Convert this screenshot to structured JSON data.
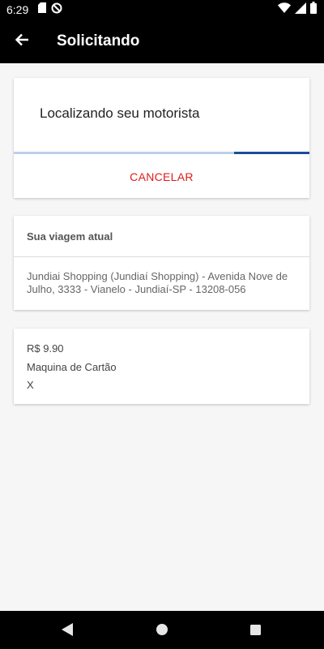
{
  "status_bar": {
    "time": "6:29",
    "icons": [
      "sd-card-icon",
      "no-sync-icon",
      "wifi-icon",
      "cellular-signal-icon",
      "battery-icon"
    ]
  },
  "app_bar": {
    "title": "Solicitando",
    "back_icon": "arrow-back-icon"
  },
  "request_card": {
    "status_text": "Localizando seu motorista",
    "cancel_label": "CANCELAR",
    "accent_color": "#1a4e96",
    "cancel_color": "#e01b1b"
  },
  "trip_card": {
    "header": "Sua viagem atual",
    "address": "Jundiai Shopping (Jundiaí Shopping) - Avenida Nove de Julho, 3333 - Vianelo - Jundiaí-SP - 13208-056"
  },
  "payment_card": {
    "price": "R$ 9.90",
    "method": "Maquina de Cartão",
    "extra": "X"
  },
  "nav_bar": {
    "icons": [
      "nav-back-icon",
      "nav-home-icon",
      "nav-recents-icon"
    ]
  }
}
